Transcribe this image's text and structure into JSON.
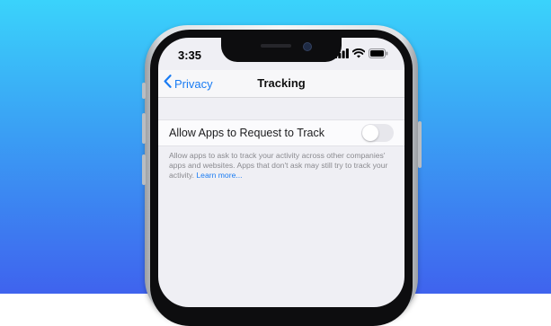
{
  "status_bar": {
    "time": "3:35",
    "icons": [
      "signal-icon",
      "wifi-icon",
      "battery-icon"
    ]
  },
  "nav": {
    "back_label": "Privacy",
    "title": "Tracking"
  },
  "setting": {
    "label": "Allow Apps to Request to Track",
    "toggle_on": false
  },
  "footer": {
    "text": "Allow apps to ask to track your activity across other companies' apps and websites. Apps that don't ask may still try to track your activity.",
    "link": "Learn more..."
  },
  "colors": {
    "accent": "#1a7cf3",
    "background_top": "#3ad3fb",
    "background_bottom": "#3f63ee",
    "screen_bg": "#efeff4"
  }
}
